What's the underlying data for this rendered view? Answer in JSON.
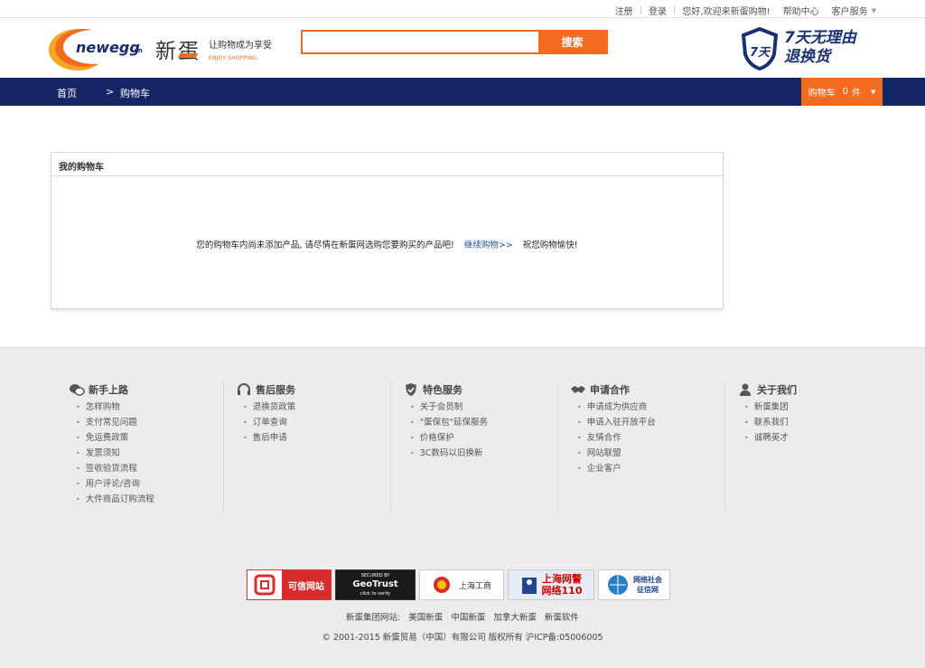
{
  "topbar": {
    "register": "注册",
    "login": "登录",
    "greeting": "您好,欢迎来新蛋购物!",
    "help": "帮助中心",
    "service": "客户服务"
  },
  "header": {
    "logo_text": "newegg",
    "logo_suffix": ".cn",
    "logo_cn": "新蛋",
    "slogan_cn": "让购物成为享受",
    "slogan_en": "ENJOY SHOPPING",
    "search_placeholder": "",
    "search_button": "搜索",
    "guarantee_line1": "7天无理由",
    "guarantee_line2": "退换货",
    "guarantee_badge": "7天"
  },
  "nav": {
    "home": "首页",
    "arrow": ">",
    "current": "购物车",
    "cart_label": "购物车",
    "cart_count": "0",
    "cart_unit": "件"
  },
  "cart": {
    "title": "我的购物车",
    "empty_message": "您的购物车内尚未添加产品, 请尽情在新蛋网选购您要购买的产品吧!",
    "continue_link": "继续购物>>",
    "wish": "祝您购物愉快!"
  },
  "footer": {
    "columns": [
      {
        "title": "新手上路",
        "icon": "chat-bubbles-icon",
        "items": [
          "怎样购物",
          "支付常见问题",
          "免运费政策",
          "发票须知",
          "签收验货流程",
          "用户评论/咨询",
          "大件商品订购流程"
        ]
      },
      {
        "title": "售后服务",
        "icon": "headset-icon",
        "items": [
          "退换货政策",
          "订单查询",
          "售后申请"
        ]
      },
      {
        "title": "特色服务",
        "icon": "shield-check-icon",
        "items": [
          "关于会员制",
          "\"蛋保包\"延保服务",
          "价格保护",
          "3C数码以旧换新"
        ]
      },
      {
        "title": "申请合作",
        "icon": "handshake-icon",
        "items": [
          "申请成为供应商",
          "申请入驻开放平台",
          "友情合作",
          "网站联盟",
          "企业客户"
        ]
      },
      {
        "title": "关于我们",
        "icon": "person-icon",
        "items": [
          "新蛋集团",
          "联系我们",
          "诚聘英才"
        ]
      }
    ],
    "badges": {
      "kexin": "可信网站",
      "geotrust_top": "SECURED BY",
      "geotrust_main": "GeoTrust",
      "geotrust_sub": "click to verify",
      "gongshang": "上海工商",
      "police_line1": "上海网警",
      "police_line2": "网络110",
      "credit_line1": "网络社会",
      "credit_line2": "征信网"
    },
    "group_sites_label": "新蛋集团网站:",
    "group_sites": [
      "美国新蛋",
      "中国新蛋",
      "加拿大新蛋",
      "新蛋软件"
    ],
    "copyright": "© 2001-2015  新蛋贸易（中国）有限公司  版权所有  沪ICP备:05006005"
  },
  "colors": {
    "brand_orange": "#f26b1e",
    "nav_navy": "#152666",
    "link_blue": "#1b4f9c"
  }
}
